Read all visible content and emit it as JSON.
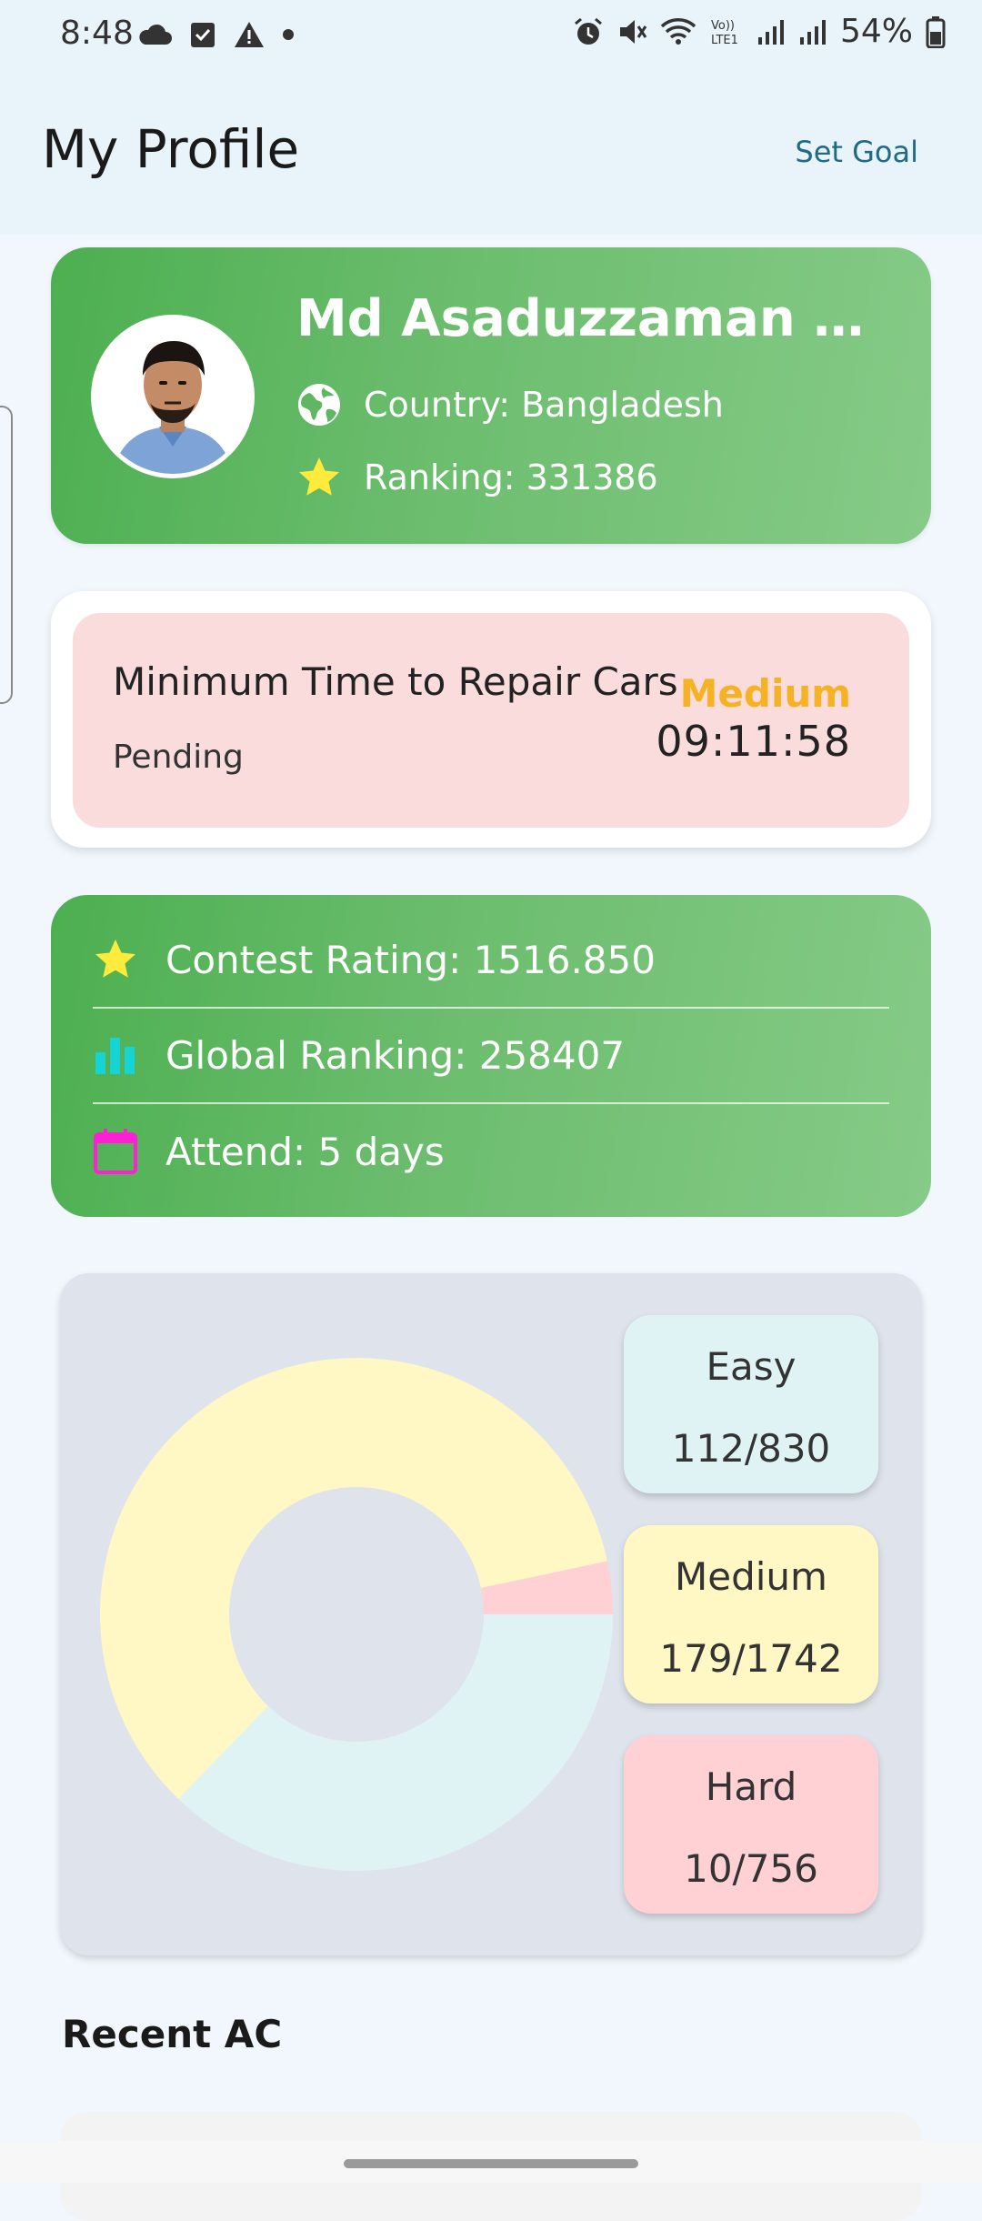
{
  "status_bar": {
    "time": "8:48",
    "battery": "54%",
    "left_icons": [
      "cloud-icon",
      "checkbox-icon",
      "warning-icon",
      "dot-icon"
    ],
    "right_icons": [
      "alarm-icon",
      "mute-icon",
      "wifi-icon",
      "volte-icon",
      "signal-icon",
      "signal-icon",
      "battery-icon"
    ]
  },
  "header": {
    "title": "My Profile",
    "action": "Set Goal"
  },
  "profile": {
    "name": "Md Asaduzzaman Nur ...",
    "country": "Country: Bangladesh",
    "ranking": "Ranking: 331386"
  },
  "daily_problem": {
    "title": "Minimum Time to Repair Cars",
    "status": "Pending",
    "difficulty": "Medium",
    "timer": "09:11:58"
  },
  "contest": {
    "rating": "Contest Rating: 1516.850",
    "global_ranking": "Global Ranking: 258407",
    "attend": "Attend: 5 days"
  },
  "chart_data": {
    "type": "pie",
    "hole": true,
    "slices": [
      {
        "label": "Easy",
        "value": 112,
        "total": 830,
        "display": "112/830",
        "color": "#dff3f5"
      },
      {
        "label": "Medium",
        "value": 179,
        "total": 1742,
        "display": "179/1742",
        "color": "#fff8c4"
      },
      {
        "label": "Hard",
        "value": 10,
        "total": 756,
        "display": "10/756",
        "color": "#ffd1d5"
      }
    ]
  },
  "recent": {
    "title": "Recent AC"
  },
  "colors": {
    "card_green_start": "#4caf50",
    "card_green_end": "#86cb88",
    "medium_text": "#f5b324",
    "star": "#ffeb3b",
    "bar_icon": "#17d4d4",
    "calendar_icon": "#ff1fd4"
  }
}
